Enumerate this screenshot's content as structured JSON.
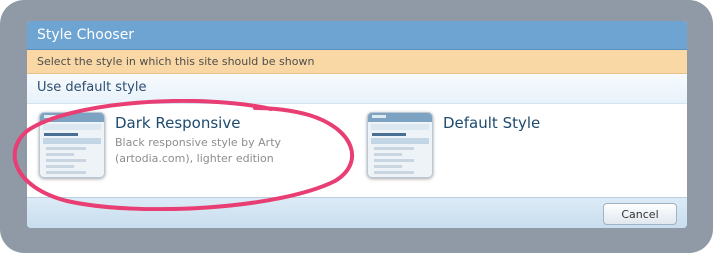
{
  "dialog": {
    "title": "Style Chooser",
    "notice": "Select the style in which this site should be shown",
    "default_link": "Use default style",
    "cancel_label": "Cancel"
  },
  "styles": [
    {
      "name": "Dark Responsive",
      "description": "Black responsive style by Arty (artodia.com), lighter edition"
    },
    {
      "name": "Default Style",
      "description": ""
    }
  ],
  "colors": {
    "title_bar": "#6ea4d1",
    "notice_bg": "#fad8a6",
    "highlight": "#e83e73"
  }
}
